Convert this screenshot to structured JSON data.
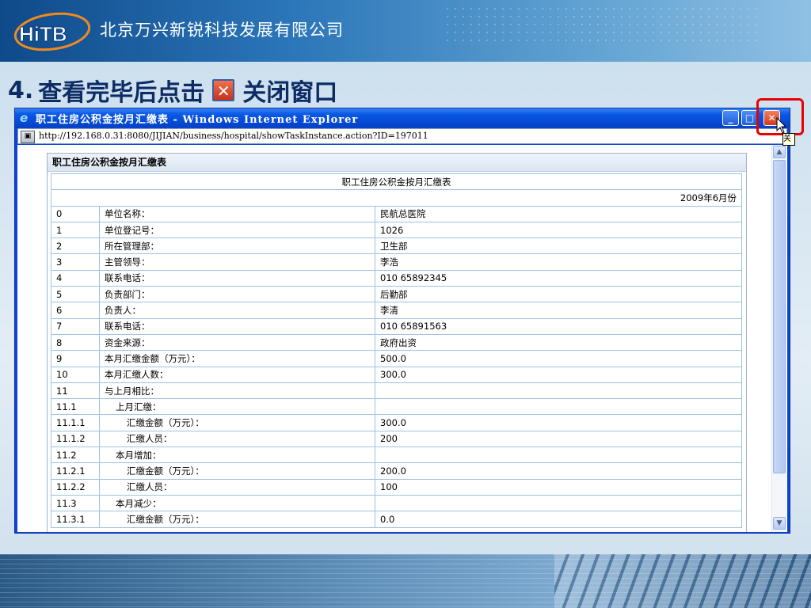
{
  "slide": {
    "company_name": "北京万兴新锐科技发展有限公司",
    "logo_text": "HiTB",
    "step_number": "4.",
    "step_text_before": "查看完毕后点击",
    "step_text_after": "关闭窗口"
  },
  "window": {
    "title": "职工住房公积金按月汇缴表 - Windows Internet Explorer",
    "url": "http://192.168.0.31:8080/JIJIAN/business/hospital/showTaskInstance.action?ID=197011",
    "buttons": {
      "minimize": "_",
      "maximize": "□",
      "close": "✕"
    },
    "tooltip_fragment": "关"
  },
  "form": {
    "panel_title": "职工住房公积金按月汇缴表",
    "report_title": "职工住房公积金按月汇缴表",
    "period": "2009年6月份",
    "rows": [
      {
        "no": "0",
        "label": "单位名称：",
        "value": "民航总医院",
        "indent": 0
      },
      {
        "no": "1",
        "label": "单位登记号：",
        "value": "1026",
        "indent": 0
      },
      {
        "no": "2",
        "label": "所在管理部：",
        "value": "卫生部",
        "indent": 0
      },
      {
        "no": "3",
        "label": "主管领导：",
        "value": "李浩",
        "indent": 0
      },
      {
        "no": "4",
        "label": "联系电话：",
        "value": "010 65892345",
        "indent": 0
      },
      {
        "no": "5",
        "label": "负责部门：",
        "value": "后勤部",
        "indent": 0
      },
      {
        "no": "6",
        "label": "负责人：",
        "value": "李清",
        "indent": 0
      },
      {
        "no": "7",
        "label": "联系电话：",
        "value": "010 65891563",
        "indent": 0
      },
      {
        "no": "8",
        "label": "资金来源：",
        "value": "政府出资",
        "indent": 0
      },
      {
        "no": "9",
        "label": "本月汇缴金额（万元）：",
        "value": "500.0",
        "indent": 0
      },
      {
        "no": "10",
        "label": "本月汇缴人数：",
        "value": "300.0",
        "indent": 0
      },
      {
        "no": "11",
        "label": "与上月相比：",
        "value": "",
        "indent": 0
      },
      {
        "no": "11.1",
        "label": "上月汇缴：",
        "value": "",
        "indent": 1
      },
      {
        "no": "11.1.1",
        "label": "汇缴金额（万元）：",
        "value": "300.0",
        "indent": 2
      },
      {
        "no": "11.1.2",
        "label": "汇缴人员：",
        "value": "200",
        "indent": 2
      },
      {
        "no": "11.2",
        "label": "本月增加：",
        "value": "",
        "indent": 1
      },
      {
        "no": "11.2.1",
        "label": "汇缴金额（万元）：",
        "value": "200.0",
        "indent": 2
      },
      {
        "no": "11.2.2",
        "label": "汇缴人员：",
        "value": "100",
        "indent": 2
      },
      {
        "no": "11.3",
        "label": "本月减少：",
        "value": "",
        "indent": 1
      },
      {
        "no": "11.3.1",
        "label": "汇缴金额（万元）：",
        "value": "0.0",
        "indent": 2
      }
    ]
  },
  "colors": {
    "title_blue": "#0d2c66",
    "highlight_red": "#e80000",
    "ie_titlebar": "#0a58e6",
    "table_border": "#9fc1e0"
  }
}
